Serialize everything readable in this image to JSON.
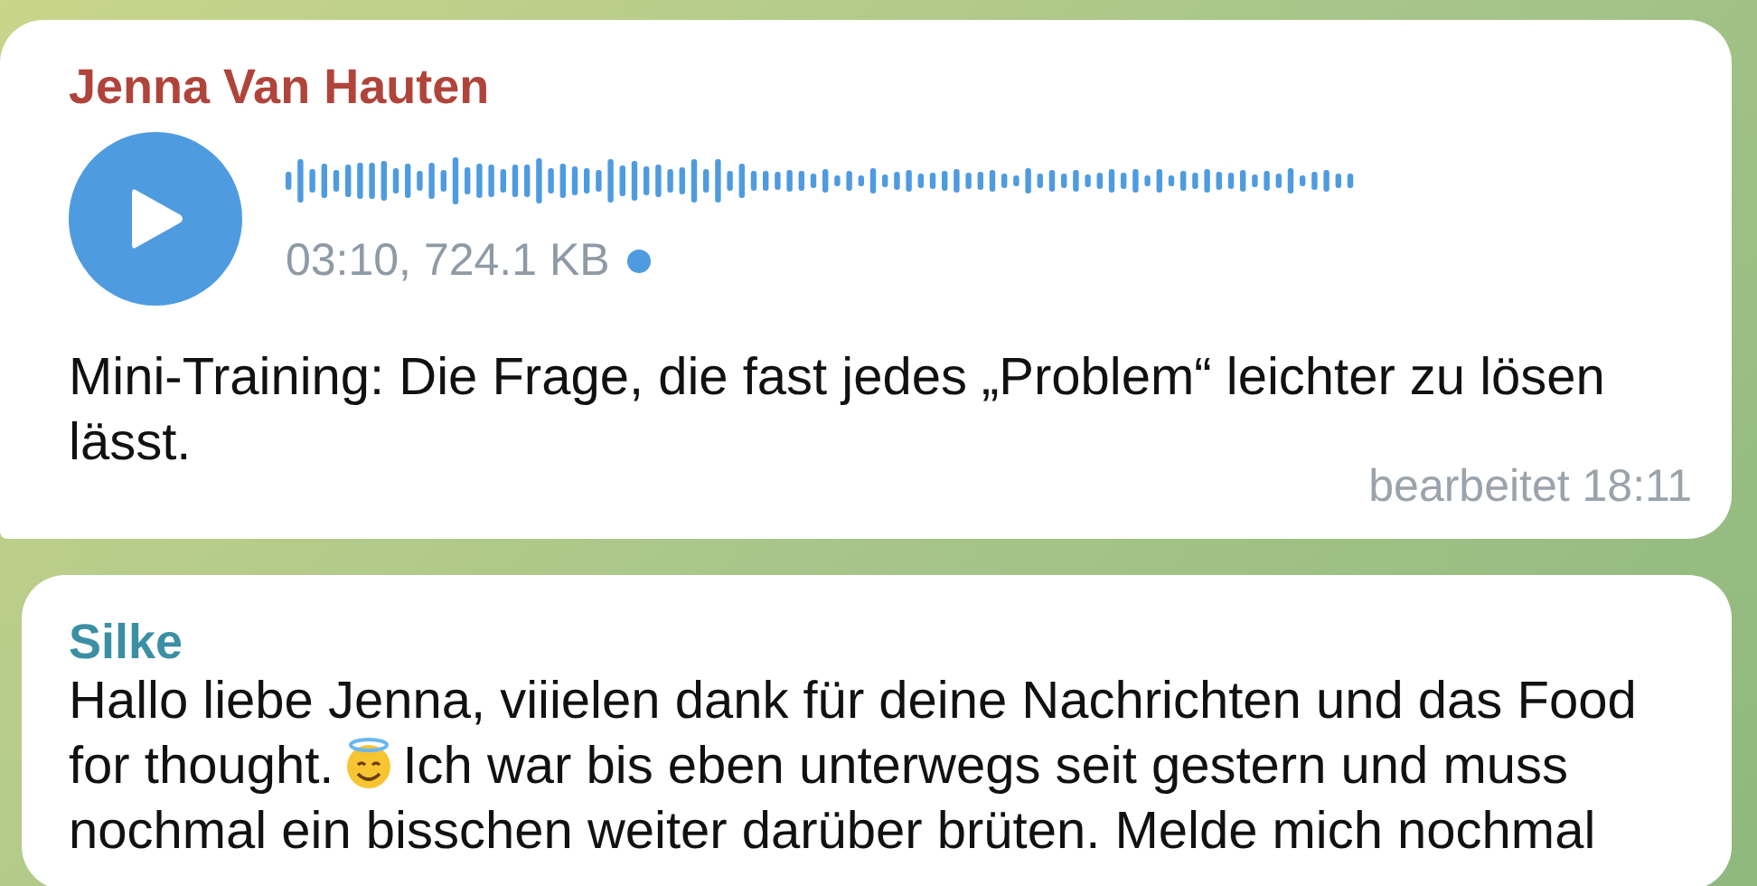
{
  "messages": [
    {
      "kind": "voice",
      "sender": "Jenna Van Hauten",
      "color": "#b0443a",
      "duration": "03:10, 724.1 KB",
      "unread": true,
      "text": "Mini-Training: Die Frage, die fast jedes „Problem“ leichter zu lösen lässt.",
      "time": "bearbeitet 18:11"
    },
    {
      "kind": "text",
      "sender": "Silke",
      "color": "#3a8fa3",
      "text_before": "Hallo liebe Jenna, viiielen dank für deine Nachrichten und das Food for thought.",
      "text_after": "Ich war bis eben unterwegs seit gestern und muss nochmal ein bisschen weiter darüber brüten. Melde mich nochmal"
    }
  ]
}
